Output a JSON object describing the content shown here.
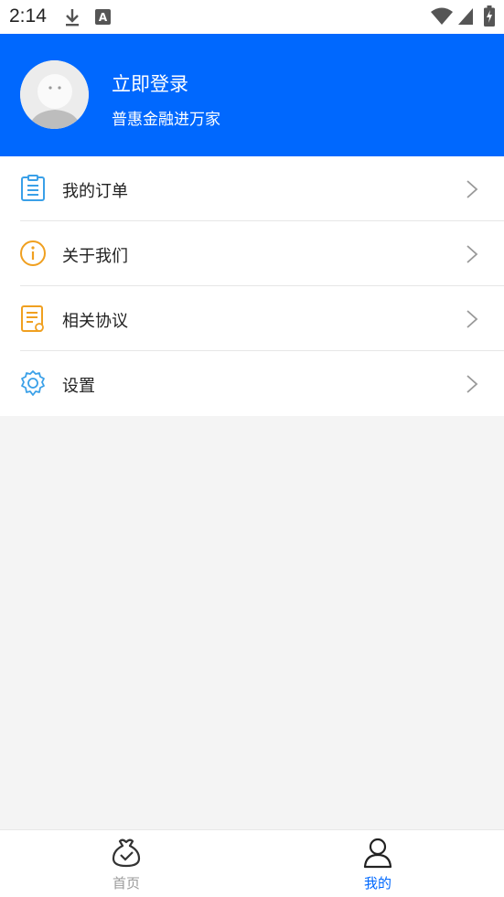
{
  "status_bar": {
    "time": "2:14",
    "icons": [
      "download-icon",
      "keyboard-a-icon",
      "wifi-icon",
      "signal-icon",
      "battery-charging-icon"
    ]
  },
  "header": {
    "title": "立即登录",
    "subtitle": "普惠金融进万家",
    "background": "#0068fe"
  },
  "menu": {
    "items": [
      {
        "label": "我的订单",
        "icon": "order-list-icon",
        "color": "#3aa0e8"
      },
      {
        "label": "关于我们",
        "icon": "info-icon",
        "color": "#f0a020"
      },
      {
        "label": "相关协议",
        "icon": "agreement-icon",
        "color": "#f0a020"
      },
      {
        "label": "设置",
        "icon": "gear-icon",
        "color": "#3aa0e8"
      }
    ]
  },
  "tabbar": {
    "tabs": [
      {
        "label": "首页",
        "icon": "home-bag-icon",
        "active": false
      },
      {
        "label": "我的",
        "icon": "person-icon",
        "active": true
      }
    ],
    "active_color": "#0068fe",
    "inactive_color": "#9a9a9a"
  }
}
